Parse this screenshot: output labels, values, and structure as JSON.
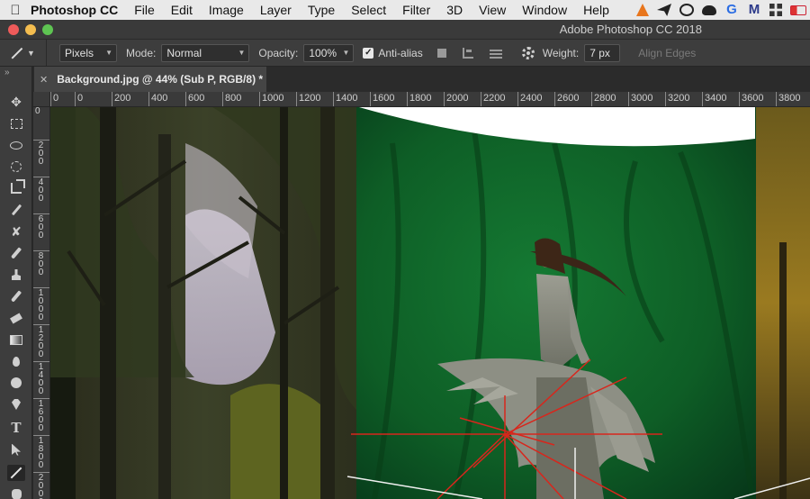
{
  "menubar": {
    "app_name": "Photoshop CC",
    "items": [
      "File",
      "Edit",
      "Image",
      "Layer",
      "Type",
      "Select",
      "Filter",
      "3D",
      "View",
      "Window",
      "Help"
    ],
    "status_icons": [
      "vlc-icon",
      "send-icon",
      "creative-cloud-icon",
      "cloud-icon",
      "google-icon",
      "malwarebytes-icon",
      "grid-icon",
      "battery-icon"
    ]
  },
  "titlebar": {
    "title": "Adobe Photoshop CC 2018"
  },
  "options": {
    "unit_select": "Pixels",
    "mode_label": "Mode:",
    "mode_value": "Normal",
    "opacity_label": "Opacity:",
    "opacity_value": "100%",
    "antialias_label": "Anti-alias",
    "weight_label": "Weight:",
    "weight_value": "7 px",
    "align_edges_label": "Align Edges"
  },
  "document": {
    "tab_title": "Background.jpg @ 44% (Sub P, RGB/8) *"
  },
  "rulers": {
    "h_labels": [
      "0",
      "0",
      "200",
      "400",
      "600",
      "800",
      "1000",
      "1200",
      "1400",
      "1600",
      "1800",
      "2000",
      "2200",
      "2400",
      "2600",
      "2800",
      "3000",
      "3200",
      "3400",
      "3600",
      "3800"
    ],
    "v_labels": [
      "0",
      "200",
      "400",
      "600",
      "800",
      "1000",
      "1200",
      "1400",
      "1600",
      "1800",
      "2000"
    ]
  },
  "tools": [
    {
      "name": "move-tool-icon"
    },
    {
      "name": "marquee-tool-icon"
    },
    {
      "name": "lasso-tool-icon"
    },
    {
      "name": "quick-select-tool-icon"
    },
    {
      "name": "crop-tool-icon"
    },
    {
      "name": "eyedropper-tool-icon"
    },
    {
      "name": "healing-brush-tool-icon"
    },
    {
      "name": "brush-tool-icon"
    },
    {
      "name": "clone-stamp-tool-icon"
    },
    {
      "name": "history-brush-tool-icon"
    },
    {
      "name": "eraser-tool-icon"
    },
    {
      "name": "gradient-tool-icon"
    },
    {
      "name": "blur-tool-icon"
    },
    {
      "name": "dodge-tool-icon"
    },
    {
      "name": "pen-tool-icon"
    },
    {
      "name": "type-tool-icon"
    },
    {
      "name": "path-selection-tool-icon"
    },
    {
      "name": "line-tool-icon"
    },
    {
      "name": "hand-tool-icon"
    }
  ],
  "colors": {
    "ui_dark": "#282828",
    "panel": "#3d3d3d",
    "green_screen": "#0f5a24",
    "guide_red": "#d8261c"
  }
}
